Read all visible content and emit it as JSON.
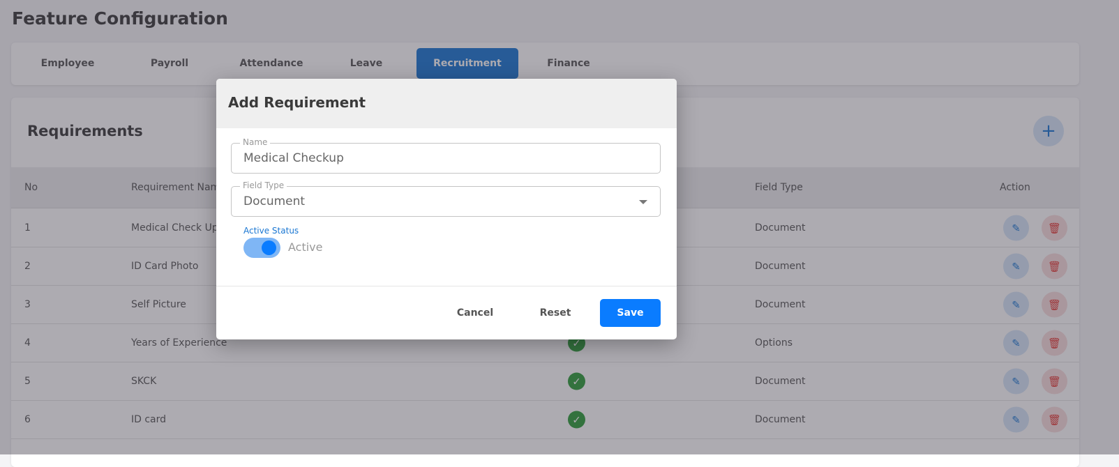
{
  "page": {
    "title": "Feature Configuration"
  },
  "tabs": [
    {
      "label": "Employee"
    },
    {
      "label": "Payroll"
    },
    {
      "label": "Attendance"
    },
    {
      "label": "Leave"
    },
    {
      "label": "Recruitment",
      "active": true
    },
    {
      "label": "Finance"
    }
  ],
  "requirements": {
    "title": "Requirements",
    "add_icon": "plus-icon",
    "columns": [
      "No",
      "Requirement Name",
      "",
      "Field Type",
      "Action"
    ],
    "rows": [
      {
        "no": "1",
        "name": "Medical Check Up",
        "active": true,
        "field_type": "Document"
      },
      {
        "no": "2",
        "name": "ID Card Photo",
        "active": true,
        "field_type": "Document"
      },
      {
        "no": "3",
        "name": "Self Picture",
        "active": true,
        "field_type": "Document"
      },
      {
        "no": "4",
        "name": "Years of Experience",
        "active": true,
        "field_type": "Options"
      },
      {
        "no": "5",
        "name": "SKCK",
        "active": true,
        "field_type": "Document"
      },
      {
        "no": "6",
        "name": "ID card",
        "active": true,
        "field_type": "Document"
      }
    ]
  },
  "modal": {
    "title": "Add Requirement",
    "name_label": "Name",
    "name_value": "Medical Checkup",
    "field_type_label": "Field Type",
    "field_type_value": "Document",
    "active_status_label": "Active Status",
    "active_status_text": "Active",
    "active_status_on": true,
    "cancel": "Cancel",
    "reset": "Reset",
    "save": "Save"
  },
  "colors": {
    "primary": "#1976d2",
    "save": "#0a7cff",
    "success": "#2e9e3a",
    "danger": "#e53935"
  }
}
